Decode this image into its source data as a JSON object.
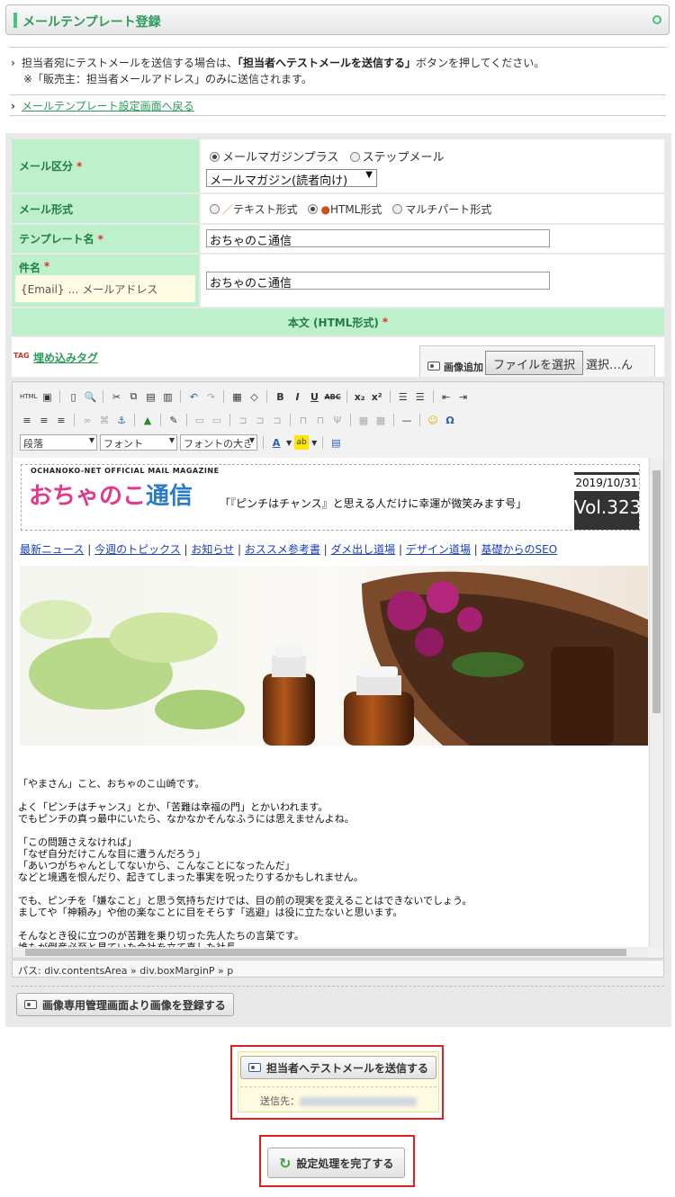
{
  "header": {
    "title": "メールテンプレート登録"
  },
  "info": {
    "line1_pre": "担当者宛にテストメールを送信する場合は、",
    "line1_bold": "「担当者へテストメールを送信する」",
    "line1_post": "ボタンを押してください。",
    "line2": "※「販売主：担当者メールアドレス」のみに送信されます。",
    "back_link": "メールテンプレート設定画面へ戻る"
  },
  "form": {
    "mail_type_label": "メール区分",
    "mail_type_options": [
      "メールマガジンプラス",
      "ステップメール"
    ],
    "mail_type_select": "メールマガジン(読者向け)",
    "format_label": "メール形式",
    "format_options": [
      "テキスト形式",
      "HTML形式",
      "マルチパート形式"
    ],
    "template_label": "テンプレート名",
    "template_value": "おちゃのこ通信",
    "subject_label": "件名",
    "subject_hint": "{Email} … メールアドレス",
    "subject_value": "おちゃのこ通信",
    "body_label": "本文 (HTML形式)",
    "required_mark": "*"
  },
  "editor": {
    "embed_tag_link": "埋め込みタグ",
    "embed_tag_icon": "TAG",
    "image_add_label": "画像追加",
    "file_button": "ファイルを選択",
    "file_status": "選択…ん",
    "toolbar_selects": [
      "段落",
      "フォント",
      "フォントの大き"
    ],
    "path_text": "パス: div.contentsArea » div.boxMarginP » p"
  },
  "magazine": {
    "subtitle": "OCHANOKO-NET OFFICIAL MAIL MAGAZINE",
    "logo_a": "おちゃのこ",
    "logo_b": "通信",
    "catch": "「『ピンチはチャンス』と思える人だけに幸運が微笑みます号」",
    "date": "2019/10/31",
    "vol": "Vol.323",
    "nav": [
      "最新ニュース",
      "今週のトピックス",
      "お知らせ",
      "おススメ参考書",
      "ダメ出し道場",
      "デザイン道場",
      "基礎からのSEO"
    ],
    "body": "「やまさん」こと、おちゃのこ山崎です。\n\nよく「ピンチはチャンス」とか、「苦難は幸福の門」とかいわれます。\nでもピンチの真っ最中にいたら、なかなかそんなふうには思えませんよね。\n\n「この問題さえなければ」\n「なぜ自分だけこんな目に遭うんだろう」\n「あいつがちゃんとしてないから、こんなことになったんだ」\nなどと境遇を恨んだり、起きてしまった事実を呪ったりするかもしれません。\n\nでも、ピンチを「嫌なこと」と思う気持ちだけでは、目の前の現実を変えることはできないでしょう。\nましてや「神頼み」や他の楽なことに目をそらす「逃避」は役に立たないと思います。\n\nそんなとき役に立つのが苦難を乗り切った先人たちの言葉です。\n誰もが倒産必至と見ていた会社を立て直した社長。"
  },
  "actions": {
    "register_image": "画像専用管理画面より画像を登録する",
    "send_test": "担当者へテストメールを送信する",
    "send_to_label": "送信先：",
    "complete": "設定処理を完了する"
  }
}
